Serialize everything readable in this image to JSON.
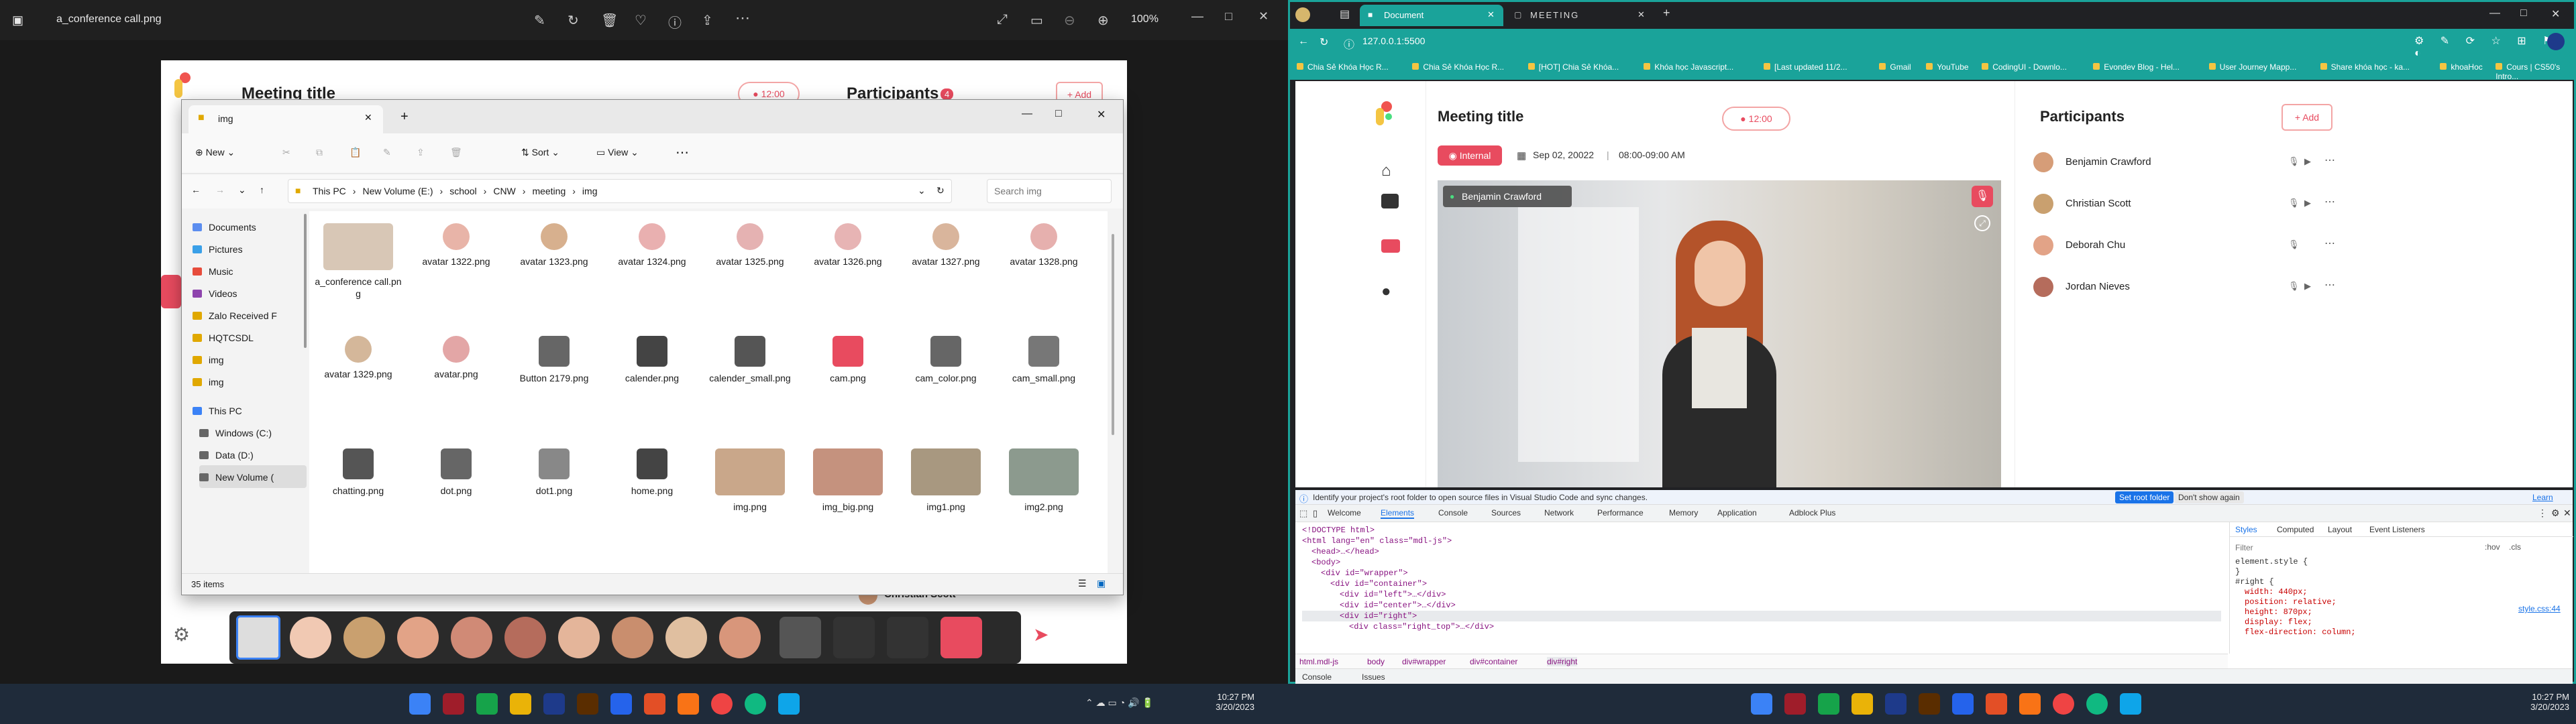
{
  "viewer": {
    "filename": "a_conference call.png",
    "zoom": "100%"
  },
  "shot": {
    "meeting_title": "Meeting title",
    "timer": "12:00",
    "participants_label": "Participants",
    "participants_count": "4",
    "add_label": "Add",
    "bottom_name": "Christian Scott"
  },
  "explorer": {
    "tab_title": "img",
    "new_label": "New",
    "sort_label": "Sort",
    "view_label": "View",
    "breadcrumb": [
      "This PC",
      "New Volume (E:)",
      "school",
      "CNW",
      "meeting",
      "img"
    ],
    "search_placeholder": "Search img",
    "nav": [
      {
        "label": "Documents",
        "icon": "documents-icon"
      },
      {
        "label": "Pictures",
        "icon": "pictures-icon"
      },
      {
        "label": "Music",
        "icon": "music-icon"
      },
      {
        "label": "Videos",
        "icon": "videos-icon"
      },
      {
        "label": "Zalo Received F",
        "icon": "folder-icon"
      },
      {
        "label": "HQTCSDL",
        "icon": "folder-icon"
      },
      {
        "label": "img",
        "icon": "folder-icon"
      },
      {
        "label": "img",
        "icon": "folder-icon"
      },
      {
        "label": "This PC",
        "icon": "pc-icon"
      },
      {
        "label": "Windows (C:)",
        "icon": "drive-icon"
      },
      {
        "label": "Data (D:)",
        "icon": "drive-icon"
      },
      {
        "label": "New Volume (",
        "icon": "drive-icon"
      }
    ],
    "files": [
      "a_conference call.png",
      "avatar 1322.png",
      "avatar 1323.png",
      "avatar 1324.png",
      "avatar 1325.png",
      "avatar 1326.png",
      "avatar 1327.png",
      "avatar 1328.png",
      "avatar 1329.png",
      "avatar.png",
      "Button 2179.png",
      "calender.png",
      "calender_small.png",
      "cam.png",
      "cam_color.png",
      "cam_small.png",
      "chatting.png",
      "dot.png",
      "dot1.png",
      "home.png",
      "img.png",
      "img_big.png",
      "img1.png",
      "img2.png"
    ],
    "status": "35 items"
  },
  "taskbar_left": {
    "time": "10:27 PM",
    "date": "3/20/2023"
  },
  "taskbar_right": {
    "time": "10:27 PM",
    "date": "3/20/2023"
  },
  "browser": {
    "tab1": "Document",
    "tab2": "MEETING",
    "url": "127.0.0.1:5500",
    "bookmarks": [
      "Chia Sẻ Khóa Học R...",
      "Chia Sẻ Khóa Học R...",
      "[HOT] Chia Sẻ Khóa...",
      "Khóa học Javascript...",
      "[Last updated 11/2...",
      "Gmail",
      "YouTube",
      "CodingUI - Downlo...",
      "Evondev Blog - Hel...",
      "User Journey Mapp...",
      "Share khóa học - ka...",
      "khoaHoc",
      "Cours | CS50's Intro..."
    ]
  },
  "app": {
    "title": "Meeting title",
    "timer": "12:00",
    "tag": "Internal",
    "date": "Sep 02, 20022",
    "time_range": "08:00-09:00 AM",
    "speaker": "Benjamin Crawford",
    "participants_label": "Participants",
    "add_label": "Add",
    "participants": [
      "Benjamin Crawford",
      "Christian Scott",
      "Deborah Chu",
      "Jordan Nieves"
    ]
  },
  "devtools": {
    "notice": "Identify your project's root folder to open source files in Visual Studio Code and sync changes.",
    "set_root": "Set root folder",
    "dont_show": "Don't show again",
    "learn_more": "Learn more",
    "tabs": [
      "Welcome",
      "Elements",
      "Console",
      "Sources",
      "Network",
      "Performance",
      "Memory",
      "Application",
      "Adblock Plus"
    ],
    "side_tabs": [
      "Styles",
      "Computed",
      "Layout",
      "Event Listeners"
    ],
    "filter_placeholder": "Filter",
    "filter_hov": ":hov",
    "filter_cls": ".cls",
    "lines": [
      "<!DOCTYPE html>",
      "<html lang=\"en\" class=\"mdl-js\">",
      "<head>…</head>",
      "<body>",
      "<div id=\"wrapper\">",
      "<div id=\"container\">",
      "<div id=\"left\">…</div>",
      "<div id=\"center\">…</div>",
      "<div id=\"right\">",
      "<div class=\"right_top\">…</div>"
    ],
    "styles": [
      "element.style {",
      "}",
      "#right {",
      "width: 440px;",
      "position: relative;",
      "height: 870px;",
      "display: flex;",
      "flex-direction: column;"
    ],
    "style_source": "style.css:44",
    "crumbs": [
      "html.mdl-js",
      "body",
      "div#wrapper",
      "div#container",
      "div#right"
    ],
    "drawer": [
      "Console",
      "Issues"
    ]
  }
}
